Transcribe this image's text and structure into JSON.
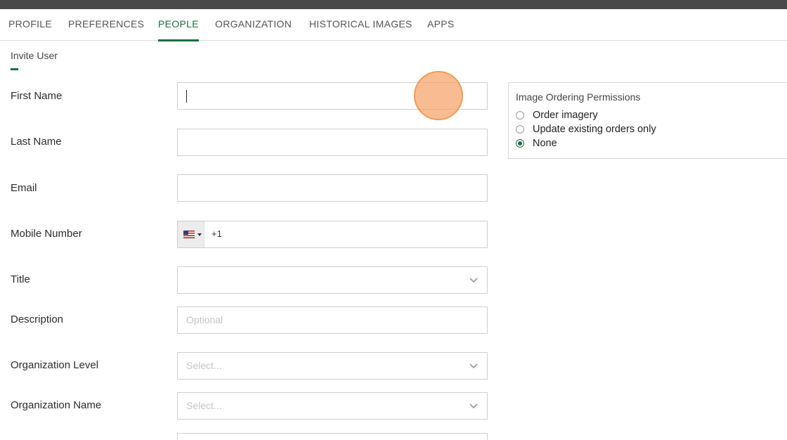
{
  "tabs": [
    {
      "label": "PROFILE",
      "active": false
    },
    {
      "label": "PREFERENCES",
      "active": false
    },
    {
      "label": "PEOPLE",
      "active": true
    },
    {
      "label": "ORGANIZATION",
      "active": false
    },
    {
      "label": "HISTORICAL IMAGES",
      "active": false
    },
    {
      "label": "APPS",
      "active": false
    }
  ],
  "section": {
    "title": "Invite User"
  },
  "form": {
    "first_name": {
      "label": "First Name",
      "value": ""
    },
    "last_name": {
      "label": "Last Name",
      "value": ""
    },
    "email": {
      "label": "Email",
      "value": ""
    },
    "mobile": {
      "label": "Mobile Number",
      "country_icon": "us-flag-icon",
      "code": "+1"
    },
    "title": {
      "label": "Title",
      "value": ""
    },
    "description": {
      "label": "Description",
      "placeholder": "Optional"
    },
    "org_level": {
      "label": "Organization Level",
      "placeholder": "Select..."
    },
    "org_name": {
      "label": "Organization Name",
      "placeholder": "Select..."
    }
  },
  "permissions": {
    "title": "Image Ordering Permissions",
    "options": [
      {
        "label": "Order imagery",
        "checked": false
      },
      {
        "label": "Update existing orders only",
        "checked": false
      },
      {
        "label": "None",
        "checked": true
      }
    ]
  },
  "colors": {
    "accent": "#1f6b43",
    "topbar": "#4a4a4a",
    "cursor_highlight": "#f7a66e"
  }
}
